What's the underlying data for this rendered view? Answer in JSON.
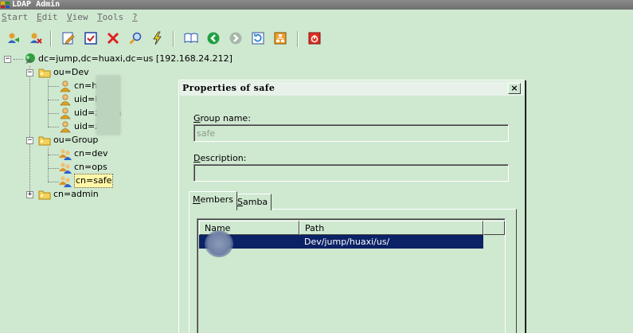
{
  "window": {
    "title": "LDAP Admin"
  },
  "menu": [
    {
      "label": "Start",
      "accel": "S",
      "rest": "tart"
    },
    {
      "label": "Edit",
      "accel": "E",
      "rest": "dit"
    },
    {
      "label": "View",
      "accel": "V",
      "rest": "iew"
    },
    {
      "label": "Tools",
      "accel": "T",
      "rest": "ools"
    },
    {
      "label": "?",
      "accel": "?",
      "rest": ""
    }
  ],
  "toolbar": {
    "buttons": [
      "connect-icon",
      "disconnect-icon",
      "edit-icon",
      "properties-icon",
      "delete-icon",
      "search-icon",
      "flash-icon",
      "book-icon",
      "back-icon",
      "forward-icon",
      "refresh-icon",
      "schema-icon",
      "exit-icon"
    ]
  },
  "tree": {
    "root": "dc=jump,dc=huaxi,dc=us [192.168.24.212]",
    "dev": "ou=Dev",
    "dev_children": [
      "cn=h",
      "uid=l",
      "uid=z",
      "uid=zh"
    ],
    "dev_child_suffix": [
      "",
      "n",
      "san",
      ""
    ],
    "group": "ou=Group",
    "group_children": [
      "cn=dev",
      "cn=ops",
      "cn=safe"
    ],
    "admin": "cn=admin"
  },
  "dialog": {
    "title": "Properties of safe",
    "close": "×",
    "group_name_label": {
      "accel": "G",
      "rest": "roup name:"
    },
    "group_name_value": "safe",
    "description_label": {
      "accel": "D",
      "rest": "escription:"
    },
    "description_value": "",
    "tabs": [
      {
        "accel": "M",
        "rest": "embers"
      },
      {
        "accel": "S",
        "rest": "amba"
      }
    ],
    "columns": [
      "Name",
      "Path"
    ],
    "rows": [
      {
        "name": "",
        "path": "Dev/jump/huaxi/us/"
      }
    ]
  },
  "colors": {
    "background": "#cfe8d0",
    "selection": "#0b2266",
    "title_bar": "#7d7d7d"
  }
}
